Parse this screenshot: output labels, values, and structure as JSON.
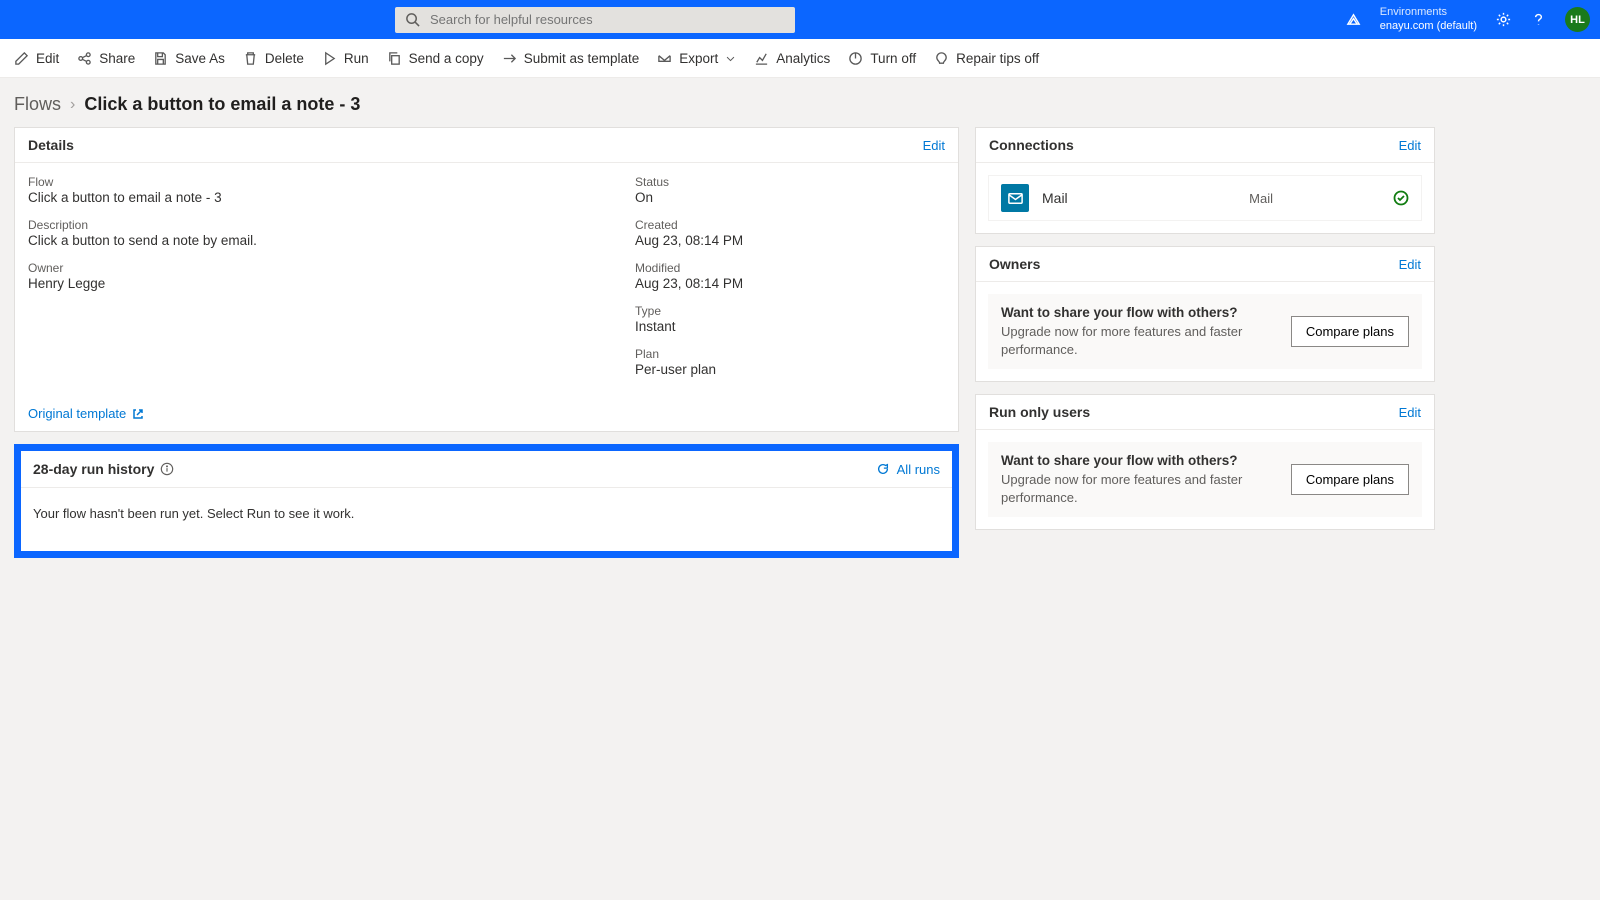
{
  "header": {
    "search_placeholder": "Search for helpful resources",
    "env_label": "Environments",
    "env_value": "enayu.com (default)",
    "avatar": "HL"
  },
  "commands": {
    "edit": "Edit",
    "share": "Share",
    "save_as": "Save As",
    "delete": "Delete",
    "run": "Run",
    "send_copy": "Send a copy",
    "submit_template": "Submit as template",
    "export": "Export",
    "analytics": "Analytics",
    "turn_off": "Turn off",
    "repair_tips": "Repair tips off"
  },
  "breadcrumb": {
    "root": "Flows",
    "current": "Click a button to email a note - 3"
  },
  "details": {
    "card_title": "Details",
    "edit": "Edit",
    "flow_label": "Flow",
    "flow_val": "Click a button to email a note - 3",
    "desc_label": "Description",
    "desc_val": "Click a button to send a note by email.",
    "owner_label": "Owner",
    "owner_val": "Henry Legge",
    "status_label": "Status",
    "status_val": "On",
    "created_label": "Created",
    "created_val": "Aug 23, 08:14 PM",
    "modified_label": "Modified",
    "modified_val": "Aug 23, 08:14 PM",
    "type_label": "Type",
    "type_val": "Instant",
    "plan_label": "Plan",
    "plan_val": "Per-user plan",
    "orig_template": "Original template"
  },
  "run_history": {
    "title": "28-day run history",
    "all_runs": "All runs",
    "empty_msg": "Your flow hasn't been run yet. Select Run to see it work."
  },
  "connections": {
    "title": "Connections",
    "edit": "Edit",
    "name": "Mail",
    "sub": "Mail"
  },
  "owners": {
    "title": "Owners",
    "edit": "Edit",
    "promo_title": "Want to share your flow with others?",
    "promo_sub": "Upgrade now for more features and faster performance.",
    "promo_btn": "Compare plans"
  },
  "run_only": {
    "title": "Run only users",
    "edit": "Edit",
    "promo_title": "Want to share your flow with others?",
    "promo_sub": "Upgrade now for more features and faster performance.",
    "promo_btn": "Compare plans"
  }
}
